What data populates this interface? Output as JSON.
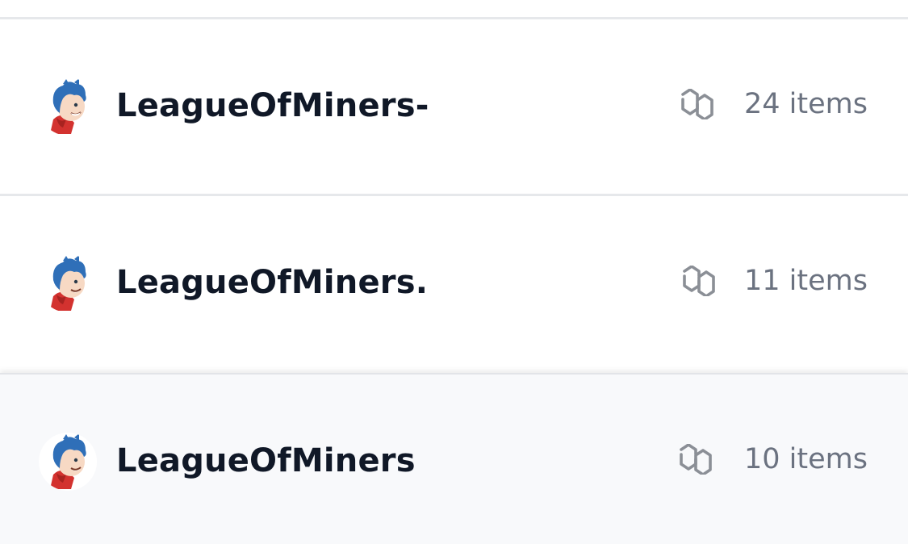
{
  "collections": [
    {
      "name": "LeagueOfMiners-",
      "count_label": "24 items",
      "chain_icon": "polygon-icon",
      "highlighted": false
    },
    {
      "name": "LeagueOfMiners.",
      "count_label": "11 items",
      "chain_icon": "polygon-icon",
      "highlighted": false
    },
    {
      "name": "LeagueOfMiners",
      "count_label": "10 items",
      "chain_icon": "polygon-icon",
      "highlighted": true
    }
  ],
  "colors": {
    "name_text": "#101827",
    "count_text": "#6b7280",
    "divider": "#e6e8eb",
    "highlight_bg": "#f8f9fb",
    "avatar_hair": "#2f6fb8",
    "avatar_shirt": "#d3322f"
  }
}
